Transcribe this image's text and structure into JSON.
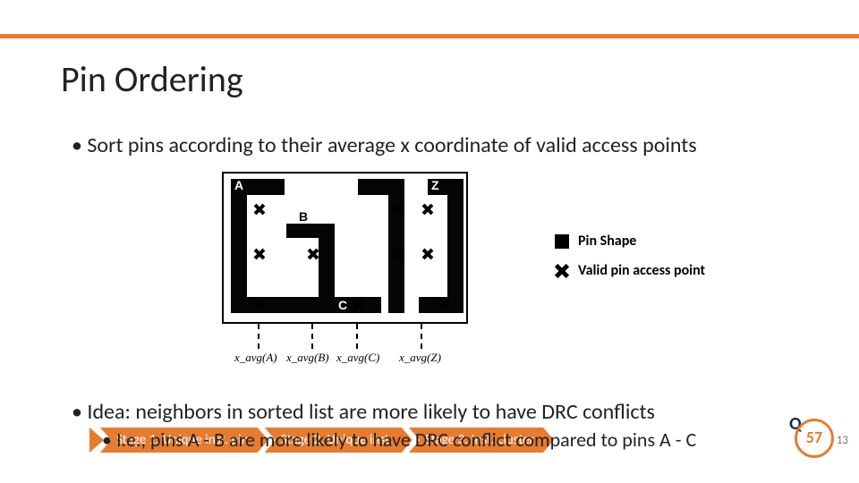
{
  "title": "Pin Ordering",
  "bullets": {
    "sort": "Sort pins according to their average x coordinate of valid access points",
    "idea": "Idea: neighbors in sorted list are more likely to have DRC conflicts",
    "ie": "I.e., pins A - B are more likely to have DRC conflict compared to pins A - C"
  },
  "figure": {
    "labelA": "A",
    "labelB": "B",
    "labelC": "C",
    "labelZ": "Z",
    "avg": {
      "A": "x_avg(A)",
      "B": "x_avg(B)",
      "C": "x_avg(C)",
      "Z": "x_avg(Z)"
    }
  },
  "legend": {
    "shape": "Pin Shape",
    "ap": "Valid pin access point"
  },
  "stages": {
    "s1": "Stage 1: Unique inst. pin",
    "s2": "Stage 2: Unique inst.",
    "s3": "Stage 3: Inst. cluster"
  },
  "logo_number": "57",
  "page": "13"
}
